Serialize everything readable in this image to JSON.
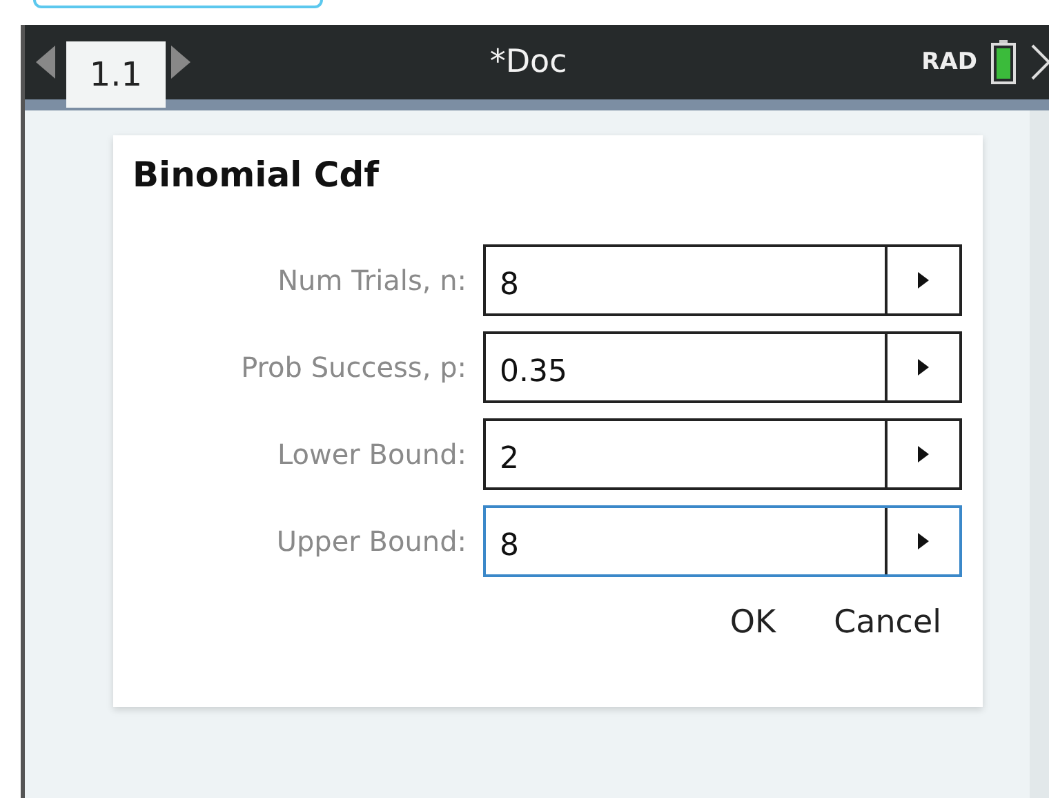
{
  "header": {
    "tab": {
      "label": "1.1",
      "selected": true
    },
    "document_title": "*Doc",
    "angle_mode": "RAD"
  },
  "dialog": {
    "title": "Binomial Cdf",
    "fields": [
      {
        "label": "Num Trials, n:",
        "value": "8",
        "focused": false
      },
      {
        "label": "Prob Success, p:",
        "value": "0.35",
        "focused": false
      },
      {
        "label": "Lower Bound:",
        "value": "2",
        "focused": false
      },
      {
        "label": "Upper Bound:",
        "value": "8",
        "focused": true
      }
    ],
    "buttons": [
      "OK",
      "Cancel"
    ]
  }
}
